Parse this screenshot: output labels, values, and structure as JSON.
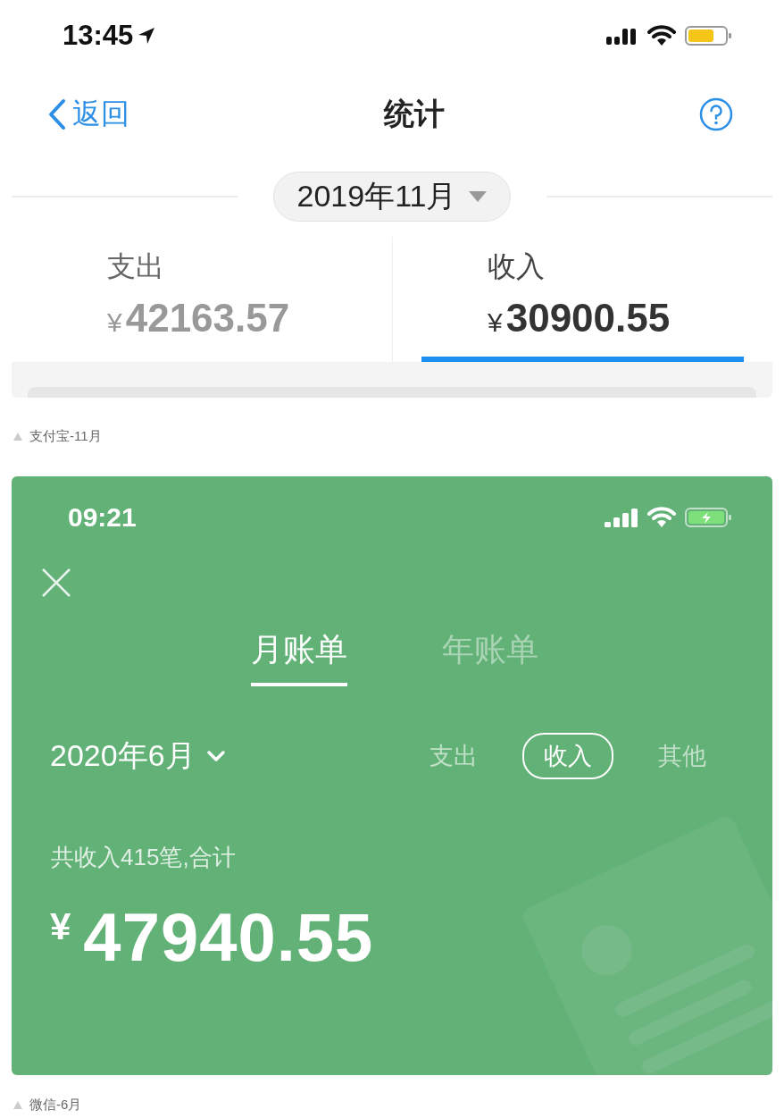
{
  "screenshot_1": {
    "status_bar": {
      "time": "13:45"
    },
    "nav": {
      "back": "返回",
      "title": "统计"
    },
    "month_picker": "2019年11月",
    "tabs": [
      {
        "label": "支出",
        "currency": "¥",
        "amount": "42163.57",
        "selected": false
      },
      {
        "label": "收入",
        "currency": "¥",
        "amount": "30900.55",
        "selected": true
      }
    ]
  },
  "caption_1": "支付宝-11月",
  "screenshot_2": {
    "status_bar": {
      "time": "09:21"
    },
    "tabs": [
      {
        "label": "月账单",
        "selected": true
      },
      {
        "label": "年账单",
        "selected": false
      }
    ],
    "month_picker": "2020年6月",
    "filters": [
      {
        "label": "支出",
        "selected": false
      },
      {
        "label": "收入",
        "selected": true
      },
      {
        "label": "其他",
        "selected": false
      }
    ],
    "summary": "共收入415笔,合计",
    "currency": "¥",
    "total": "47940.55"
  },
  "caption_2": "微信-6月"
}
